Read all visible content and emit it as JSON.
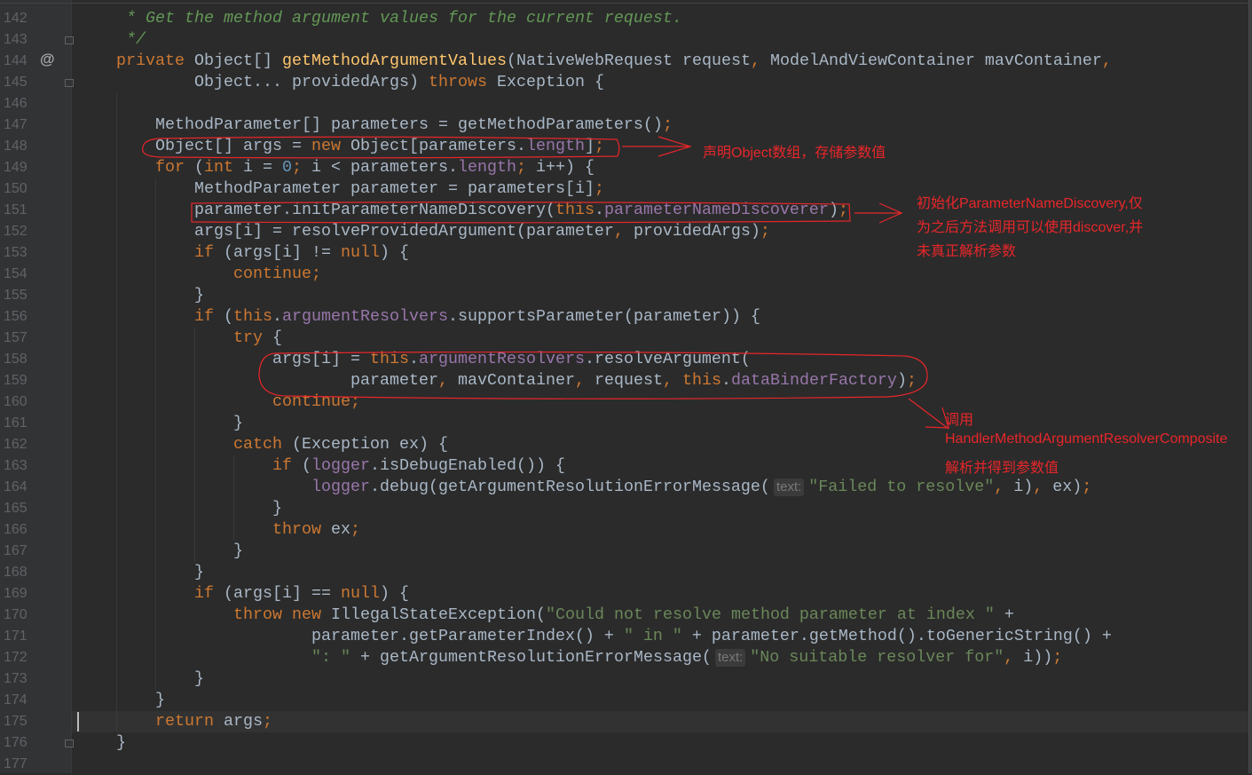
{
  "editor": {
    "current_line": 175,
    "gutter_marker": "@",
    "lines": [
      {
        "num": "142",
        "tokens": [
          {
            "c": "c",
            "t": " * Get the method argument values for the current request."
          }
        ]
      },
      {
        "num": "143",
        "tokens": [
          {
            "c": "c",
            "t": " */"
          }
        ]
      },
      {
        "num": "144",
        "tokens": [
          {
            "c": "k",
            "t": "private "
          },
          {
            "c": "t",
            "t": "Object[] "
          },
          {
            "c": "m",
            "t": "getMethodArgumentValues"
          },
          {
            "c": "t",
            "t": "(NativeWebRequest request"
          },
          {
            "c": "k",
            "t": ", "
          },
          {
            "c": "t",
            "t": "ModelAndViewContainer mavContainer"
          },
          {
            "c": "k",
            "t": ","
          }
        ]
      },
      {
        "num": "145",
        "tokens": [
          {
            "c": "t",
            "t": "        Object... providedArgs) "
          },
          {
            "c": "k",
            "t": "throws "
          },
          {
            "c": "t",
            "t": "Exception {"
          }
        ]
      },
      {
        "num": "146",
        "tokens": []
      },
      {
        "num": "147",
        "tokens": [
          {
            "c": "t",
            "t": "    MethodParameter[] parameters = getMethodParameters()"
          },
          {
            "c": "k",
            "t": ";"
          }
        ]
      },
      {
        "num": "148",
        "tokens": [
          {
            "c": "t",
            "t": "    Object[] args = "
          },
          {
            "c": "k",
            "t": "new "
          },
          {
            "c": "t",
            "t": "Object[parameters."
          },
          {
            "c": "f",
            "t": "length"
          },
          {
            "c": "t",
            "t": "]"
          },
          {
            "c": "k",
            "t": ";"
          }
        ]
      },
      {
        "num": "149",
        "tokens": [
          {
            "c": "t",
            "t": "    "
          },
          {
            "c": "k",
            "t": "for "
          },
          {
            "c": "t",
            "t": "("
          },
          {
            "c": "k",
            "t": "int "
          },
          {
            "c": "t",
            "t": "i = "
          },
          {
            "c": "n",
            "t": "0"
          },
          {
            "c": "k",
            "t": "; "
          },
          {
            "c": "t",
            "t": "i < parameters."
          },
          {
            "c": "f",
            "t": "length"
          },
          {
            "c": "k",
            "t": "; "
          },
          {
            "c": "t",
            "t": "i++) {"
          }
        ]
      },
      {
        "num": "150",
        "tokens": [
          {
            "c": "t",
            "t": "        MethodParameter parameter = parameters[i]"
          },
          {
            "c": "k",
            "t": ";"
          }
        ]
      },
      {
        "num": "151",
        "tokens": [
          {
            "c": "t",
            "t": "        parameter.initParameterNameDiscovery("
          },
          {
            "c": "k",
            "t": "this"
          },
          {
            "c": "t",
            "t": "."
          },
          {
            "c": "f",
            "t": "parameterNameDiscoverer"
          },
          {
            "c": "t",
            "t": ")"
          },
          {
            "c": "k",
            "t": ";"
          }
        ]
      },
      {
        "num": "152",
        "tokens": [
          {
            "c": "t",
            "t": "        args[i] = resolveProvidedArgument(parameter"
          },
          {
            "c": "k",
            "t": ", "
          },
          {
            "c": "t",
            "t": "providedArgs)"
          },
          {
            "c": "k",
            "t": ";"
          }
        ]
      },
      {
        "num": "153",
        "tokens": [
          {
            "c": "t",
            "t": "        "
          },
          {
            "c": "k",
            "t": "if "
          },
          {
            "c": "t",
            "t": "(args[i] != "
          },
          {
            "c": "k",
            "t": "null"
          },
          {
            "c": "t",
            "t": ") {"
          }
        ]
      },
      {
        "num": "154",
        "tokens": [
          {
            "c": "t",
            "t": "            "
          },
          {
            "c": "k",
            "t": "continue;"
          }
        ]
      },
      {
        "num": "155",
        "tokens": [
          {
            "c": "t",
            "t": "        }"
          }
        ]
      },
      {
        "num": "156",
        "tokens": [
          {
            "c": "t",
            "t": "        "
          },
          {
            "c": "k",
            "t": "if "
          },
          {
            "c": "t",
            "t": "("
          },
          {
            "c": "k",
            "t": "this"
          },
          {
            "c": "t",
            "t": "."
          },
          {
            "c": "f",
            "t": "argumentResolvers"
          },
          {
            "c": "t",
            "t": ".supportsParameter(parameter)) {"
          }
        ]
      },
      {
        "num": "157",
        "tokens": [
          {
            "c": "t",
            "t": "            "
          },
          {
            "c": "k",
            "t": "try "
          },
          {
            "c": "t",
            "t": "{"
          }
        ]
      },
      {
        "num": "158",
        "tokens": [
          {
            "c": "t",
            "t": "                args[i] = "
          },
          {
            "c": "k",
            "t": "this"
          },
          {
            "c": "t",
            "t": "."
          },
          {
            "c": "f",
            "t": "argumentResolvers"
          },
          {
            "c": "t",
            "t": ".resolveArgument("
          }
        ]
      },
      {
        "num": "159",
        "tokens": [
          {
            "c": "t",
            "t": "                        parameter"
          },
          {
            "c": "k",
            "t": ", "
          },
          {
            "c": "t",
            "t": "mavContainer"
          },
          {
            "c": "k",
            "t": ", "
          },
          {
            "c": "t",
            "t": "request"
          },
          {
            "c": "k",
            "t": ", this"
          },
          {
            "c": "t",
            "t": "."
          },
          {
            "c": "f",
            "t": "dataBinderFactory"
          },
          {
            "c": "t",
            "t": ")"
          },
          {
            "c": "k",
            "t": ";"
          }
        ]
      },
      {
        "num": "160",
        "tokens": [
          {
            "c": "t",
            "t": "                "
          },
          {
            "c": "k",
            "t": "continue;"
          }
        ]
      },
      {
        "num": "161",
        "tokens": [
          {
            "c": "t",
            "t": "            }"
          }
        ]
      },
      {
        "num": "162",
        "tokens": [
          {
            "c": "t",
            "t": "            "
          },
          {
            "c": "k",
            "t": "catch "
          },
          {
            "c": "t",
            "t": "(Exception ex) {"
          }
        ]
      },
      {
        "num": "163",
        "tokens": [
          {
            "c": "t",
            "t": "                "
          },
          {
            "c": "k",
            "t": "if "
          },
          {
            "c": "t",
            "t": "("
          },
          {
            "c": "f",
            "t": "logger"
          },
          {
            "c": "t",
            "t": ".isDebugEnabled()) {"
          }
        ]
      },
      {
        "num": "164",
        "tokens": [
          {
            "c": "t",
            "t": "                    "
          },
          {
            "c": "f",
            "t": "logger"
          },
          {
            "c": "t",
            "t": ".debug(getArgumentResolutionErrorMessage("
          },
          {
            "c": "h",
            "t": "text:"
          },
          {
            "c": "s",
            "t": "\"Failed to resolve\""
          },
          {
            "c": "k",
            "t": ", "
          },
          {
            "c": "t",
            "t": "i)"
          },
          {
            "c": "k",
            "t": ", "
          },
          {
            "c": "t",
            "t": "ex)"
          },
          {
            "c": "k",
            "t": ";"
          }
        ]
      },
      {
        "num": "165",
        "tokens": [
          {
            "c": "t",
            "t": "                }"
          }
        ]
      },
      {
        "num": "166",
        "tokens": [
          {
            "c": "t",
            "t": "                "
          },
          {
            "c": "k",
            "t": "throw "
          },
          {
            "c": "t",
            "t": "ex"
          },
          {
            "c": "k",
            "t": ";"
          }
        ]
      },
      {
        "num": "167",
        "tokens": [
          {
            "c": "t",
            "t": "            }"
          }
        ]
      },
      {
        "num": "168",
        "tokens": [
          {
            "c": "t",
            "t": "        }"
          }
        ]
      },
      {
        "num": "169",
        "tokens": [
          {
            "c": "t",
            "t": "        "
          },
          {
            "c": "k",
            "t": "if "
          },
          {
            "c": "t",
            "t": "(args[i] == "
          },
          {
            "c": "k",
            "t": "null"
          },
          {
            "c": "t",
            "t": ") {"
          }
        ]
      },
      {
        "num": "170",
        "tokens": [
          {
            "c": "t",
            "t": "            "
          },
          {
            "c": "k",
            "t": "throw new "
          },
          {
            "c": "t",
            "t": "IllegalStateException("
          },
          {
            "c": "s",
            "t": "\"Could not resolve method parameter at index \""
          },
          {
            "c": "t",
            "t": " +"
          }
        ]
      },
      {
        "num": "171",
        "tokens": [
          {
            "c": "t",
            "t": "                    parameter.getParameterIndex() + "
          },
          {
            "c": "s",
            "t": "\" in \""
          },
          {
            "c": "t",
            "t": " + parameter.getMethod().toGenericString() +"
          }
        ]
      },
      {
        "num": "172",
        "tokens": [
          {
            "c": "t",
            "t": "                    "
          },
          {
            "c": "s",
            "t": "\": \""
          },
          {
            "c": "t",
            "t": " + getArgumentResolutionErrorMessage("
          },
          {
            "c": "h",
            "t": "text:"
          },
          {
            "c": "s",
            "t": "\"No suitable resolver for\""
          },
          {
            "c": "k",
            "t": ", "
          },
          {
            "c": "t",
            "t": "i))"
          },
          {
            "c": "k",
            "t": ";"
          }
        ]
      },
      {
        "num": "173",
        "tokens": [
          {
            "c": "t",
            "t": "        }"
          }
        ]
      },
      {
        "num": "174",
        "tokens": [
          {
            "c": "t",
            "t": "    }"
          }
        ]
      },
      {
        "num": "175",
        "tokens": [
          {
            "c": "t",
            "t": "    "
          },
          {
            "c": "k",
            "t": "return "
          },
          {
            "c": "t",
            "t": "args"
          },
          {
            "c": "k",
            "t": ";"
          }
        ]
      },
      {
        "num": "176",
        "tokens": [
          {
            "c": "t",
            "t": "}"
          }
        ]
      },
      {
        "num": "177",
        "tokens": []
      }
    ]
  },
  "annotations": {
    "color": "#e8262a",
    "note1": "声明Object数组，存储参数值",
    "note2": [
      "初始化ParameterNameDiscovery,仅",
      "为之后方法调用可以使用discover,并",
      "未真正解析参数"
    ],
    "note3": [
      "调用",
      "HandlerMethodArgumentResolverComposite",
      "解析并得到参数值"
    ]
  }
}
